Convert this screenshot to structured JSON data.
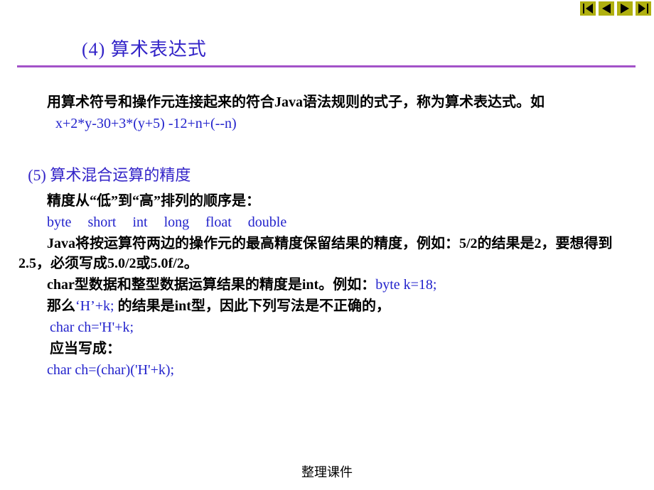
{
  "nav": {
    "first_icon": "first-icon",
    "prev_icon": "prev-icon",
    "next_icon": "next-icon",
    "last_icon": "last-icon"
  },
  "heading4": "(4) 算术表达式",
  "para1": "用算术符号和操作元连接起来的符合Java语法规则的式子，称为算术表达式。如",
  "expr1": "x+2*y-30+3*(y+5) -12+n+(--n)",
  "heading5": "(5) 算术混合运算的精度",
  "prec_intro": "精度从“低”到“高”排列的顺序是：",
  "prec": {
    "t1": "byte",
    "t2": "short",
    "t3": "int",
    "t4": "long",
    "t5": "float",
    "t6": "double"
  },
  "para2": "Java将按运算符两边的操作元的最高精度保留结果的精度，例如：5/2的结果是2，要想得到2.5，必须写成5.0/2或5.0f/2。",
  "para3a": "char型数据和整型数据运算结果的精度是int。例如：",
  "para3b": "byte  k=18;",
  "para4a": "那么",
  "para4b": "‘H’+k;",
  "para4c": " 的结果是int型，因此下列写法是不正确的，",
  "line_wrong": "char  ch='H'+k;",
  "should_write": "应当写成：",
  "line_ok": "char ch=(char)('H'+k);",
  "footer": "整理课件"
}
